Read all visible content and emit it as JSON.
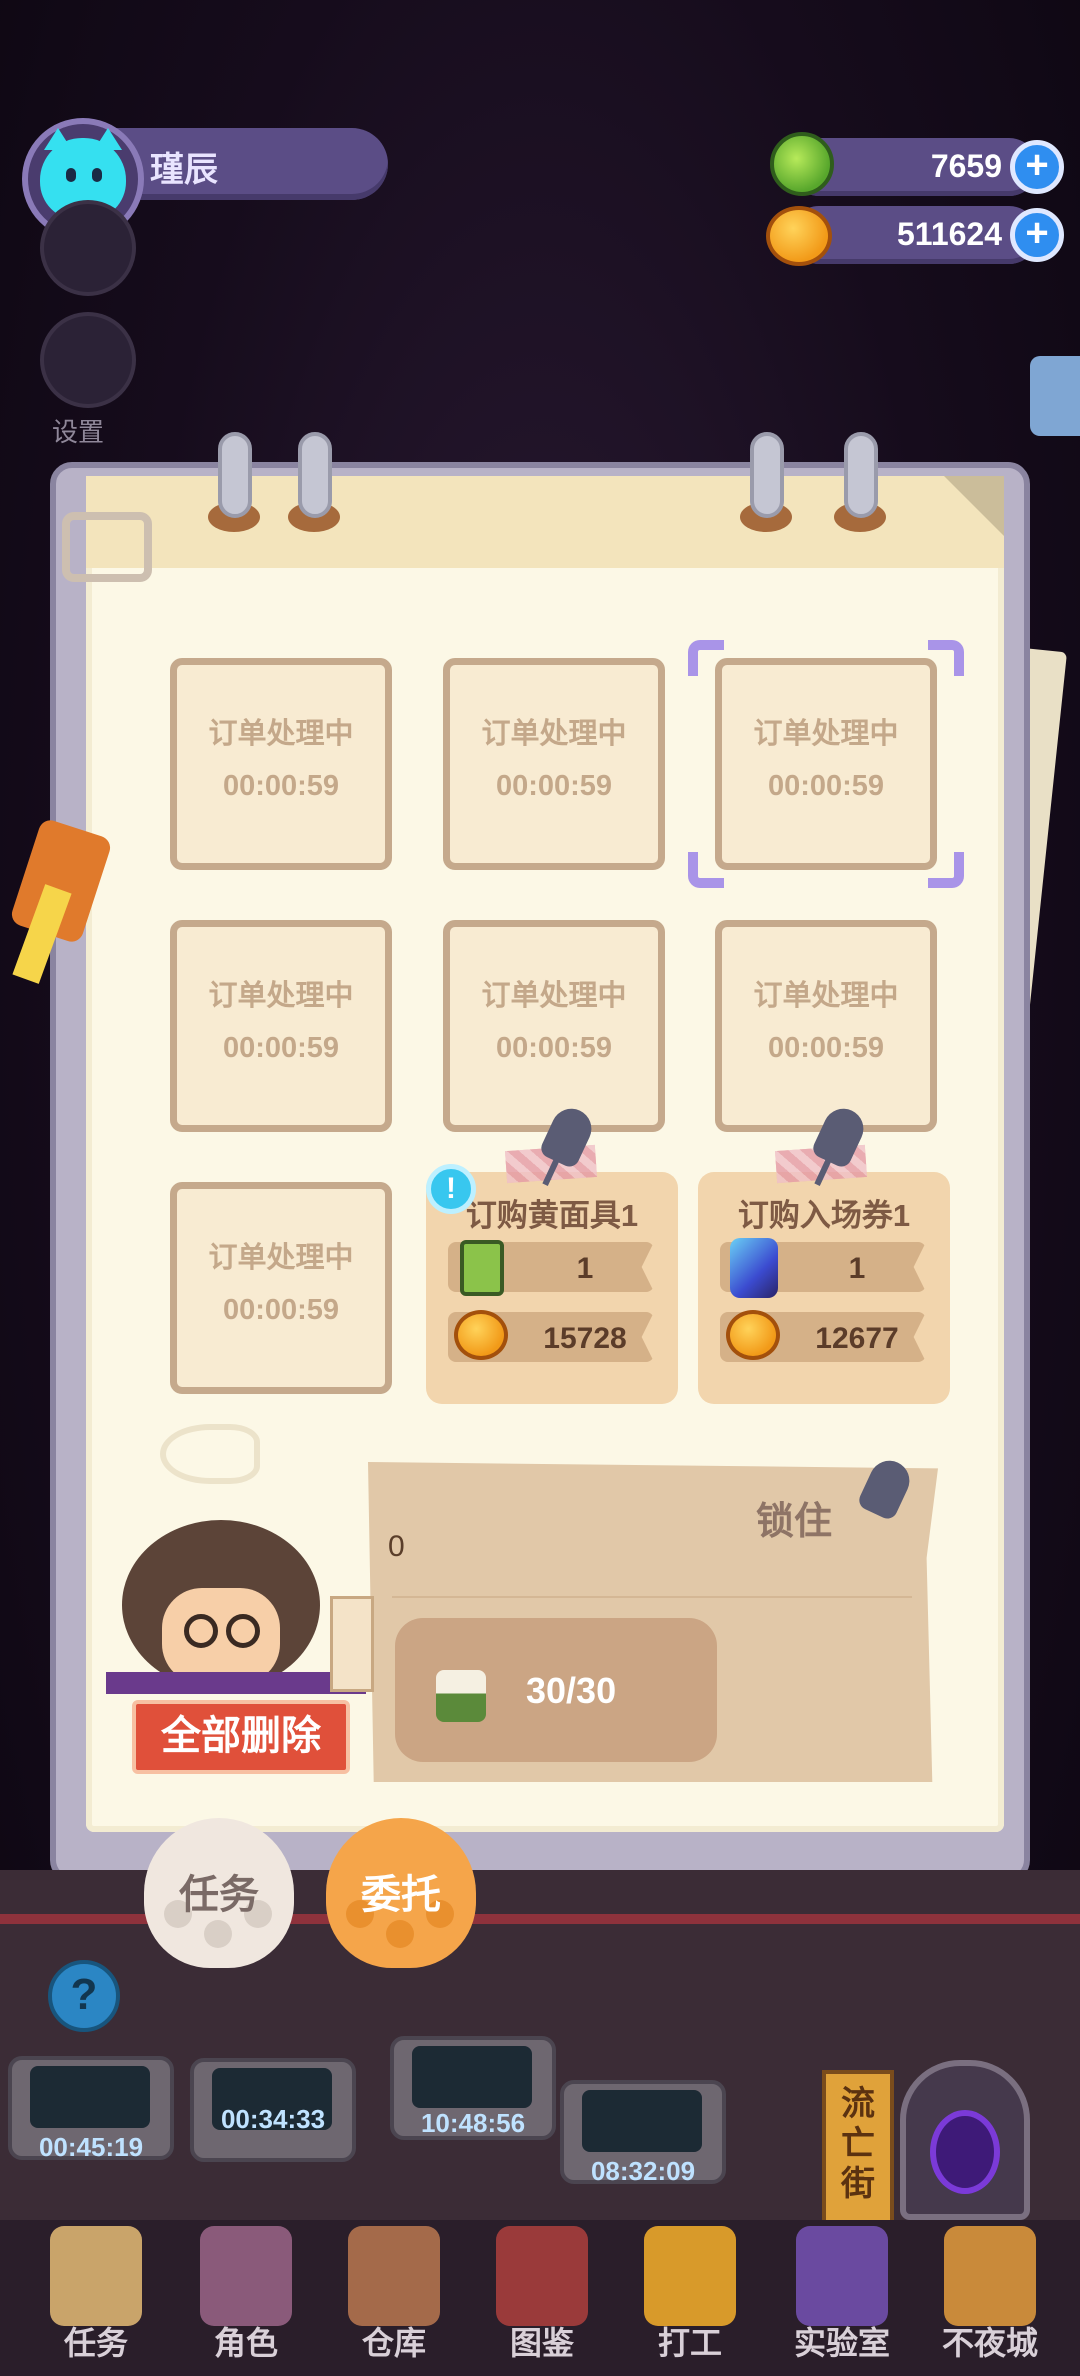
{
  "profile": {
    "name": "瑾辰"
  },
  "sidebar": {
    "settings_label": "设置"
  },
  "currencies": [
    {
      "icon": "green-gem-icon",
      "value": "7659"
    },
    {
      "icon": "gold-coin-icon",
      "value": "511624"
    }
  ],
  "slots": [
    {
      "status": "订单处理中",
      "timer": "00:00:59"
    },
    {
      "status": "订单处理中",
      "timer": "00:00:59"
    },
    {
      "status": "订单处理中",
      "timer": "00:00:59"
    },
    {
      "status": "订单处理中",
      "timer": "00:00:59"
    },
    {
      "status": "订单处理中",
      "timer": "00:00:59"
    },
    {
      "status": "订单处理中",
      "timer": "00:00:59"
    },
    {
      "status": "订单处理中",
      "timer": "00:00:59"
    }
  ],
  "orders": [
    {
      "title": "订购黄面具1",
      "item_icon": "battery-icon",
      "qty": "1",
      "price": "15728"
    },
    {
      "title": "订购入场券1",
      "item_icon": "bolt-icon",
      "qty": "1",
      "price": "12677"
    }
  ],
  "panel": {
    "input_value": "0",
    "lock_label": "锁住",
    "capacity": "30/30"
  },
  "actions": {
    "delete_all": "全部删除",
    "tab_tasks": "任务",
    "tab_commission": "委托"
  },
  "ovens": [
    {
      "timer": "00:45:19"
    },
    {
      "timer": "00:34:33"
    },
    {
      "timer": "10:48:56"
    },
    {
      "timer": "08:32:09"
    }
  ],
  "scene": {
    "exile_street": "流亡街"
  },
  "bottom_nav": [
    {
      "label": "任务",
      "color": "#c9a46a"
    },
    {
      "label": "角色",
      "color": "#8a5a7a"
    },
    {
      "label": "仓库",
      "color": "#a46a4a"
    },
    {
      "label": "图鉴",
      "color": "#9a3a3a"
    },
    {
      "label": "打工",
      "color": "#d89a2a"
    },
    {
      "label": "实验室",
      "color": "#6a4aa0"
    },
    {
      "label": "不夜城",
      "color": "#c98a3a"
    }
  ]
}
